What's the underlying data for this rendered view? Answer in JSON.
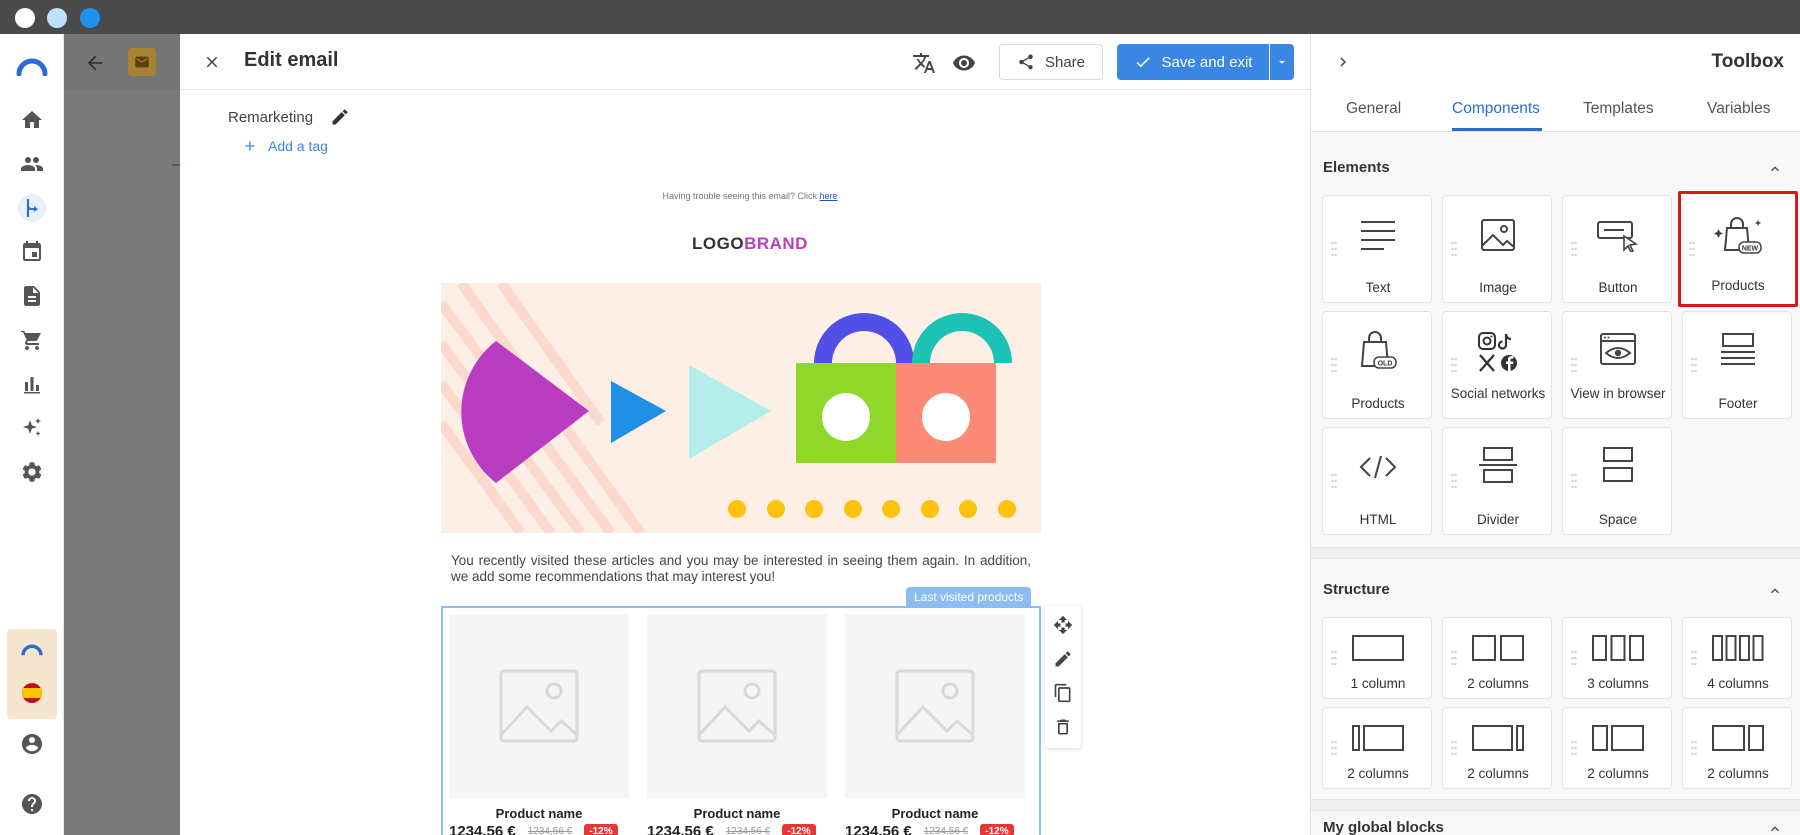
{
  "editor": {
    "title": "Edit email",
    "share_label": "Share",
    "save_label": "Save and exit",
    "campaign_name": "Remarketing",
    "add_tag_label": "Add a tag"
  },
  "email": {
    "trouble_text": "Having trouble seeing this email? Click ",
    "trouble_link": "here",
    "logo_part1": "LOGO",
    "logo_part2": "BRAND",
    "body_text": "You recently visited these articles and you may be interested in seeing them again. In addition, we add some recommendations that may interest you!",
    "block_badge": "Last visited products",
    "products": [
      {
        "name": "Product name",
        "price": "1234,56 €",
        "old_price": "1234,56 €",
        "discount": "-12%"
      },
      {
        "name": "Product name",
        "price": "1234,56 €",
        "old_price": "1234,56 €",
        "discount": "-12%"
      },
      {
        "name": "Product name",
        "price": "1234,56 €",
        "old_price": "1234,56 €",
        "discount": "-12%"
      }
    ]
  },
  "toolbox": {
    "title": "Toolbox",
    "tabs": [
      "General",
      "Components",
      "Templates",
      "Variables"
    ],
    "active_tab": "Components",
    "elements_header": "Elements",
    "structure_header": "Structure",
    "global_header": "My global blocks",
    "elements": [
      {
        "label": "Text",
        "icon": "text-lines-icon"
      },
      {
        "label": "Image",
        "icon": "image-icon"
      },
      {
        "label": "Button",
        "icon": "button-cursor-icon"
      },
      {
        "label": "Products",
        "icon": "products-new-icon",
        "badge": "NEW",
        "selected": true
      },
      {
        "label": "Products",
        "icon": "products-old-icon",
        "badge": "OLD"
      },
      {
        "label": "Social networks",
        "icon": "social-networks-icon"
      },
      {
        "label": "View in browser",
        "icon": "view-in-browser-icon"
      },
      {
        "label": "Footer",
        "icon": "footer-icon"
      },
      {
        "label": "HTML",
        "icon": "html-code-icon"
      },
      {
        "label": "Divider",
        "icon": "divider-icon"
      },
      {
        "label": "Space",
        "icon": "space-icon"
      }
    ],
    "structure": [
      {
        "label": "1 column"
      },
      {
        "label": "2 columns"
      },
      {
        "label": "3 columns"
      },
      {
        "label": "4 columns"
      },
      {
        "label": "2 columns"
      },
      {
        "label": "2 columns"
      },
      {
        "label": "2 columns"
      },
      {
        "label": "2 columns"
      }
    ]
  },
  "colors": {
    "accent": "#3a86e3",
    "highlight": "#d31b1b",
    "brand_purple": "#b83dbf"
  }
}
